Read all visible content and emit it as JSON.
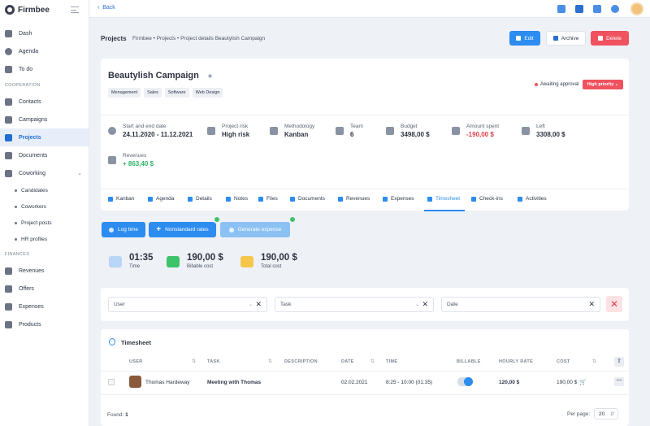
{
  "app": {
    "name": "Firmbee"
  },
  "sidebar": {
    "items_top": [
      {
        "label": "Dash",
        "icon": "dashboard-icon"
      },
      {
        "label": "Agenda",
        "icon": "clock-icon"
      },
      {
        "label": "To do",
        "icon": "list-icon"
      }
    ],
    "section_cooperation": "COOPERATION",
    "items_coop": [
      {
        "label": "Contacts",
        "icon": "user-icon"
      },
      {
        "label": "Campaigns",
        "icon": "campaign-icon"
      },
      {
        "label": "Projects",
        "icon": "clipboard-icon",
        "active": true
      },
      {
        "label": "Documents",
        "icon": "document-icon"
      },
      {
        "label": "Coworking",
        "icon": "folder-icon"
      }
    ],
    "coworking_sub": [
      "Candidates",
      "Coworkers",
      "Project posts",
      "HR profiles"
    ],
    "section_finances": "FINANCES",
    "items_fin": [
      {
        "label": "Revenues",
        "icon": "wallet-icon"
      },
      {
        "label": "Offers",
        "icon": "offer-icon"
      },
      {
        "label": "Expenses",
        "icon": "cart-icon"
      },
      {
        "label": "Products",
        "icon": "box-icon"
      }
    ]
  },
  "topbar": {
    "back_label": "Back"
  },
  "header": {
    "title": "Projects",
    "breadcrumb": "Firmbee  •  Projects  •  Project details Beautylish Campaign",
    "edit_label": "Edit",
    "archive_label": "Archive",
    "delete_label": "Delete"
  },
  "project": {
    "name": "Beautylish Campaign",
    "tags": [
      "Menagement",
      "Sales",
      "Software",
      "Web Design"
    ],
    "status": "Awaiting approval",
    "priority": "High priority",
    "info": {
      "dates_label": "Start and end date",
      "dates_value": "24.11.2020 - 11.12.2021",
      "risk_label": "Project risk",
      "risk_value": "High risk",
      "method_label": "Methodology",
      "method_value": "Kanban",
      "team_label": "Team",
      "team_value": "6",
      "budget_label": "Budget",
      "budget_value": "3498,00 $",
      "spent_label": "Amount spent",
      "spent_value": "-190,00 $",
      "left_label": "Left",
      "left_value": "3308,00 $",
      "revenues_label": "Revenues",
      "revenues_value": "+ 863,40 $"
    },
    "tabs": [
      "Kanban",
      "Agenda",
      "Details",
      "Notes",
      "Files",
      "Documents",
      "Revenues",
      "Expenses",
      "Timesheet",
      "Check-ins",
      "Activities"
    ]
  },
  "actions": {
    "log_time": "Log time",
    "nonstandard_rates": "Nonstandard rates",
    "generate_expense": "Generate expense"
  },
  "stats": {
    "time_value": "01:35",
    "time_label": "Time",
    "billable_value": "190,00 $",
    "billable_label": "Billable cost",
    "total_value": "190,00 $",
    "total_label": "Total cost"
  },
  "filters": {
    "user": "User",
    "task": "Task",
    "date": "Date"
  },
  "timesheet": {
    "title": "Timesheet",
    "columns": [
      "USER",
      "TASK",
      "DESCRIPTION",
      "DATE",
      "TIME",
      "BILLABLE",
      "HOURLY RATE",
      "COST"
    ],
    "rows": [
      {
        "user": "Thomas Hardeway",
        "task": "Meeting with Thomas",
        "description": "",
        "date": "02.02.2021",
        "time": "8:25 - 10:00 (01:35)",
        "billable": true,
        "rate": "120,00 $",
        "cost": "190,00 $"
      }
    ],
    "found_label": "Found:",
    "found_count": "1",
    "per_page_label": "Per page:",
    "per_page_value": "20"
  }
}
